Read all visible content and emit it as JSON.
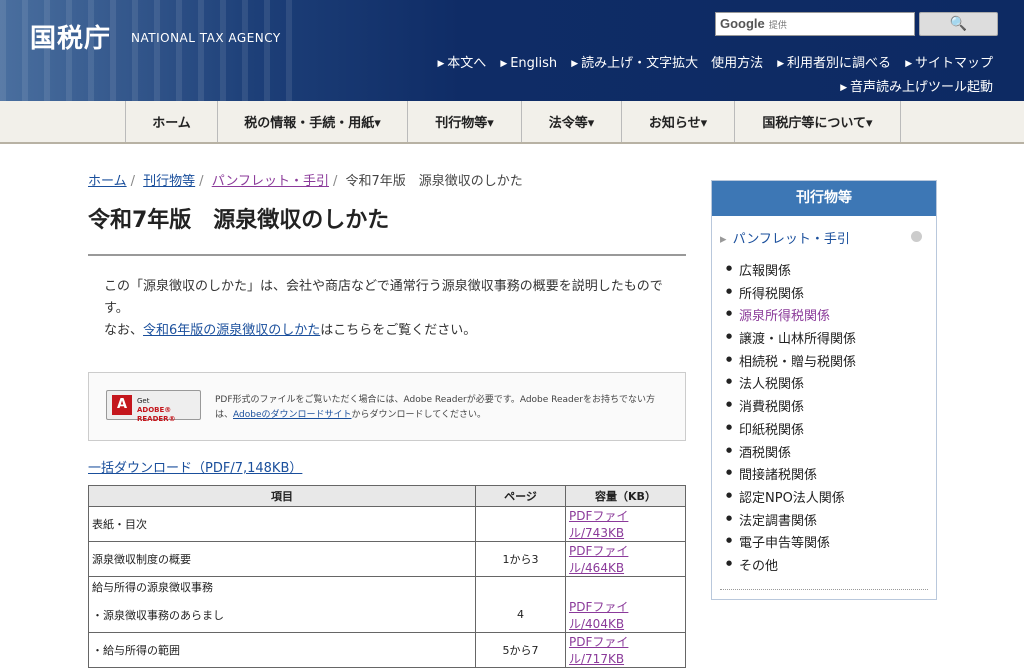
{
  "header": {
    "logo": "国税庁",
    "logo_en": "NATIONAL TAX AGENCY",
    "search_brand": "Google",
    "search_provided": "提供",
    "search_button": "🔍",
    "util_links": [
      "本文へ",
      "English",
      "読み上げ・文字拡大　使用方法",
      "利用者別に調べる",
      "サイトマップ"
    ],
    "util_link2": "音声読み上げツール起動"
  },
  "gnav": [
    "ホーム",
    "税の情報・手続・用紙▾",
    "刊行物等▾",
    "法令等▾",
    "お知らせ▾",
    "国税庁等について▾"
  ],
  "breadcrumb": {
    "home": "ホーム",
    "publications": "刊行物等",
    "pamphlet": "パンフレット・手引",
    "current": "令和7年版　源泉徴収のしかた"
  },
  "page_title": "令和7年版　源泉徴収のしかた",
  "intro": {
    "line1": "この「源泉徴収のしかた」は、会社や商店などで通常行う源泉徴収事務の概要を説明したものです。",
    "line2_pre": "なお、",
    "line2_link": "令和6年版の源泉徴収のしかた",
    "line2_post": "はこちらをご覧ください。"
  },
  "adobe": {
    "badge_get": "Get",
    "badge_name": "ADOBE® READER®",
    "text1": "PDF形式のファイルをご覧いただく場合には、Adobe Readerが必要です。Adobe Readerをお持ちでない方は、",
    "link": "Adobeのダウンロードサイト",
    "text2": "からダウンロードしてください。"
  },
  "bulk_download": "一括ダウンロード（PDF/7,148KB）",
  "table": {
    "headers": [
      "項目",
      "ページ",
      "容量（KB）"
    ],
    "rows": [
      {
        "item": "表紙・目次",
        "page": "",
        "link": "PDFファイル/743KB"
      },
      {
        "item": "源泉徴収制度の概要",
        "page": "1から3",
        "link": "PDFファイル/464KB"
      },
      {
        "item": "給与所得の源泉徴収事務",
        "page": "",
        "link": ""
      },
      {
        "item": "・源泉徴収事務のあらまし",
        "page": "4",
        "link": "PDFファイル/404KB"
      },
      {
        "item": "・給与所得の範囲",
        "page": "5から7",
        "link": "PDFファイル/717KB"
      }
    ]
  },
  "sidebar": {
    "title": "刊行物等",
    "sub": "パンフレット・手引",
    "items": [
      "広報関係",
      "所得税関係",
      "源泉所得税関係",
      "譲渡・山林所得関係",
      "相続税・贈与税関係",
      "法人税関係",
      "消費税関係",
      "印紙税関係",
      "酒税関係",
      "間接諸税関係",
      "認定NPO法人関係",
      "法定調書関係",
      "電子申告等関係",
      "その他"
    ]
  }
}
